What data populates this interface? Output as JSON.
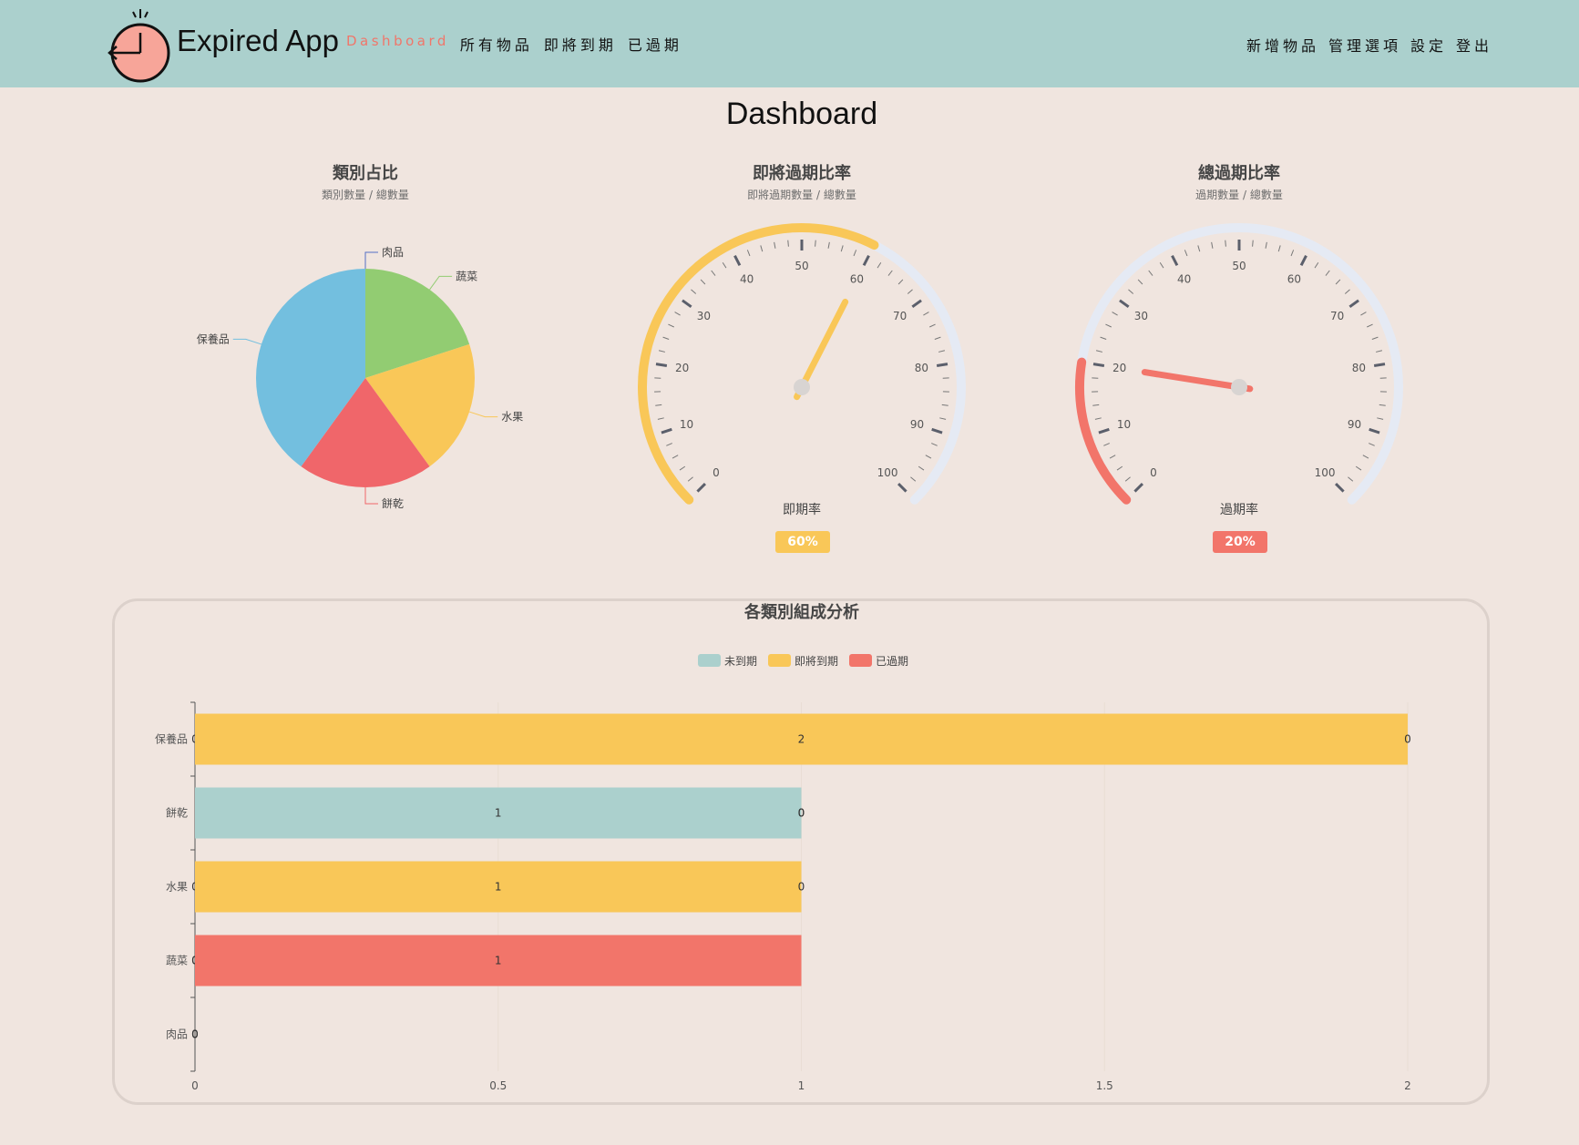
{
  "app": {
    "brand": "Expired App"
  },
  "nav": {
    "left": [
      "Dashboard",
      "所有物品",
      "即將到期",
      "已過期"
    ],
    "right": [
      "新增物品",
      "管理選項",
      "設定",
      "登出"
    ]
  },
  "page": {
    "title": "Dashboard"
  },
  "panels": {
    "pie": {
      "title": "類別占比",
      "subtitle": "類別數量 / 總數量"
    },
    "soon": {
      "title": "即將過期比率",
      "subtitle": "即將過期數量 / 總數量",
      "label": "即期率",
      "badge": "60%",
      "value": 60,
      "color": "#f9c758"
    },
    "expired": {
      "title": "總過期比率",
      "subtitle": "過期數量 / 總數量",
      "label": "過期率",
      "badge": "20%",
      "value": 20,
      "color": "#f2756a"
    },
    "gauge_ticks": [
      "0",
      "10",
      "20",
      "30",
      "40",
      "50",
      "60",
      "70",
      "80",
      "90",
      "100"
    ]
  },
  "colors": {
    "navbar": "#abd0cd",
    "background": "#f0e5df",
    "teal": "#abd0cd",
    "yellow": "#f9c758",
    "red": "#f2756a",
    "blue": "#73bfdf",
    "green": "#92cc72",
    "track": "#e5eaf4"
  },
  "chart_data": [
    {
      "type": "pie",
      "title": "類別占比",
      "categories": [
        "肉品",
        "蔬菜",
        "水果",
        "餅乾",
        "保養品"
      ],
      "values": [
        0,
        1,
        1,
        1,
        2
      ],
      "colors": [
        "#5470c6",
        "#92cc72",
        "#f9c758",
        "#f0666a",
        "#73bfdf"
      ]
    },
    {
      "type": "bar",
      "orientation": "horizontal",
      "stacked": true,
      "title": "各類別組成分析",
      "legend_position": "top",
      "categories": [
        "保養品",
        "餅乾",
        "水果",
        "蔬菜",
        "肉品"
      ],
      "series": [
        {
          "name": "未到期",
          "color": "#abd0cd",
          "values": [
            0,
            1,
            0,
            0,
            0
          ]
        },
        {
          "name": "即將到期",
          "color": "#f9c758",
          "values": [
            2,
            0,
            1,
            0,
            0
          ]
        },
        {
          "name": "已過期",
          "color": "#f2756a",
          "values": [
            0,
            0,
            0,
            1,
            0
          ]
        }
      ],
      "xlim": [
        0,
        2
      ],
      "x_ticks": [
        "0",
        "0.5",
        "1",
        "1.5",
        "2"
      ],
      "grid": true
    }
  ]
}
